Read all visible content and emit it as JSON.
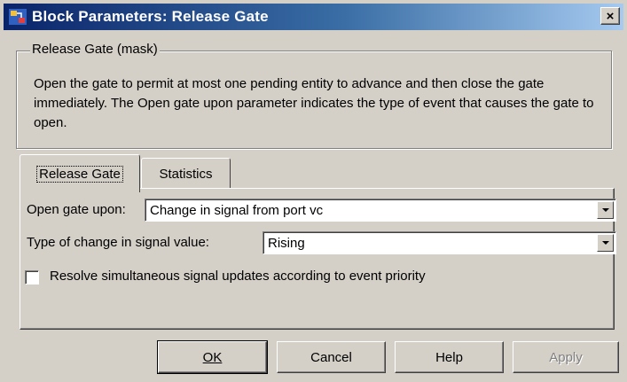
{
  "window": {
    "title": "Block Parameters: Release Gate",
    "close_glyph": "×",
    "icon": "simulink-block-icon"
  },
  "group": {
    "legend": "Release Gate (mask)",
    "description": "Open the gate to permit at most one pending entity to advance and then close the gate immediately. The Open gate upon parameter indicates the type of event that causes the gate to open."
  },
  "tabs": [
    {
      "label": "Release Gate",
      "selected": true
    },
    {
      "label": "Statistics",
      "selected": false
    }
  ],
  "params": {
    "open_gate_label": "Open gate upon:",
    "open_gate_value": "Change in signal from port vc",
    "change_type_label": "Type of change in signal value:",
    "change_type_value": "Rising",
    "resolve_label": "Resolve simultaneous signal updates according to event priority",
    "resolve_checked": false
  },
  "buttons": {
    "ok": "OK",
    "cancel": "Cancel",
    "help": "Help",
    "apply": "Apply"
  },
  "colors": {
    "title_start": "#0a246a",
    "title_end": "#a6caf0",
    "face": "#d4d0c8"
  }
}
